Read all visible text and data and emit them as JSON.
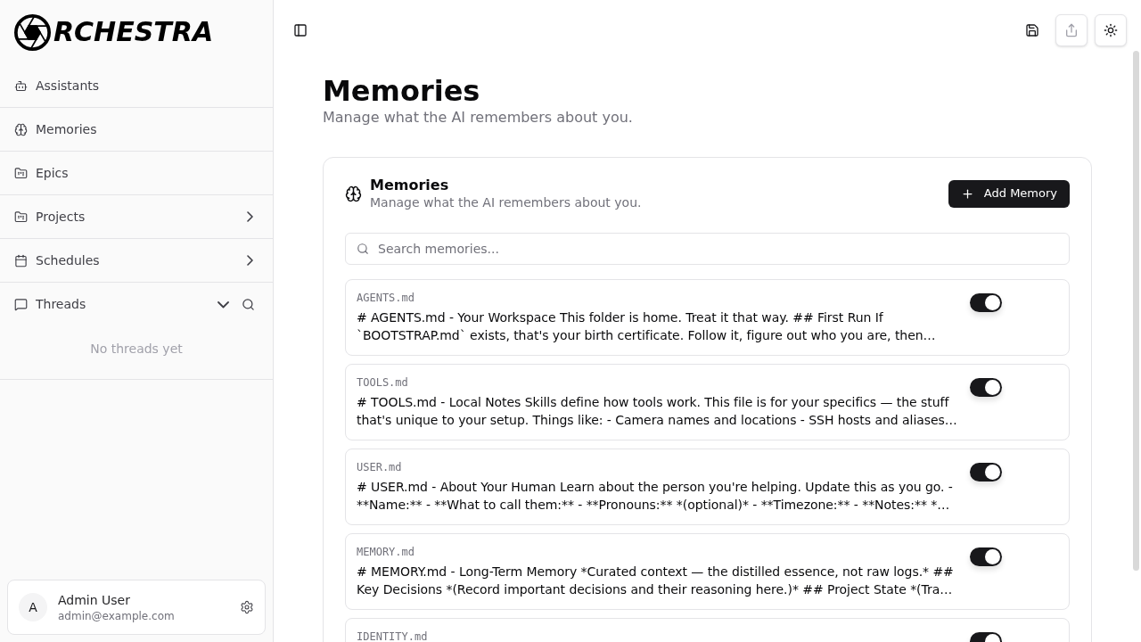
{
  "sidebar": {
    "logo_text": "RCHESTRA",
    "nav": [
      {
        "label": "Assistants",
        "kind": "link"
      },
      {
        "label": "Memories",
        "kind": "link"
      },
      {
        "label": "Epics",
        "kind": "link"
      },
      {
        "label": "Projects",
        "kind": "group",
        "expanded": false
      },
      {
        "label": "Schedules",
        "kind": "group",
        "expanded": false
      }
    ],
    "threads": {
      "label": "Threads",
      "expanded": true,
      "empty_text": "No threads yet"
    },
    "user": {
      "initial": "A",
      "name": "Admin User",
      "email": "admin@example.com"
    }
  },
  "toolbar": {
    "actions": [
      {
        "kind": "save",
        "disabled": false
      },
      {
        "kind": "share",
        "disabled": true
      },
      {
        "kind": "theme",
        "disabled": false
      }
    ]
  },
  "page": {
    "title": "Memories",
    "subtitle": "Manage what the AI remembers about you."
  },
  "memories": {
    "title": "Memories",
    "subtitle": "Manage what the AI remembers about you.",
    "add_button": "Add Memory",
    "search": {
      "placeholder": "Search memories..."
    },
    "items": [
      {
        "name": "AGENTS.md",
        "content": "# AGENTS.md - Your Workspace This folder is home. Treat it that way. ## First Run If `BOOTSTRAP.md` exists, that's your birth certificate. Follow it, figure out who you are, then…",
        "enabled": true
      },
      {
        "name": "TOOLS.md",
        "content": "# TOOLS.md - Local Notes Skills define how tools work. This file is for your specifics — the stuff that's unique to your setup. Things like: - Camera names and locations - SSH hosts and aliases…",
        "enabled": true
      },
      {
        "name": "USER.md",
        "content": "# USER.md - About Your Human Learn about the person you're helping. Update this as you go. - **Name:** - **What to call them:** - **Pronouns:** *(optional)* - **Timezone:** - **Notes:** *…",
        "enabled": true
      },
      {
        "name": "MEMORY.md",
        "content": "# MEMORY.md - Long-Term Memory *Curated context — the distilled essence, not raw logs.* ## Key Decisions *(Record important decisions and their reasoning here.)* ## Project State *(Tra…",
        "enabled": true
      },
      {
        "name": "IDENTITY.md",
        "enabled": true
      }
    ]
  }
}
